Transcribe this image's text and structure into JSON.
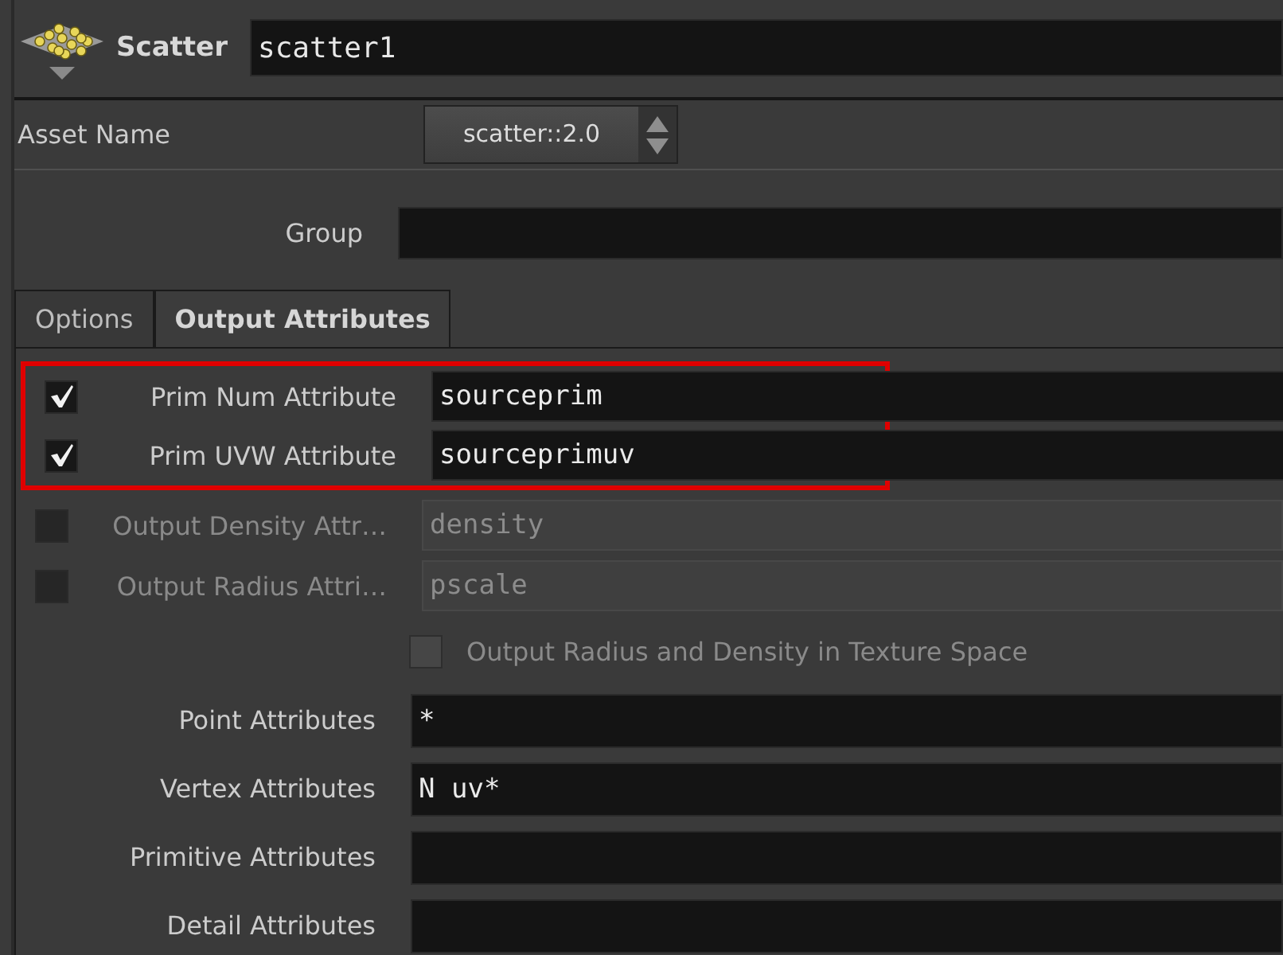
{
  "node": {
    "type_label": "Scatter",
    "name": "scatter1"
  },
  "asset": {
    "label": "Asset Name",
    "value": "scatter::2.0"
  },
  "group": {
    "label": "Group"
  },
  "tabs": [
    {
      "label": "Options",
      "selected": false
    },
    {
      "label": "Output Attributes",
      "selected": true
    }
  ],
  "rows": [
    {
      "kind": "check_field",
      "label": "Prim Num Attribute",
      "checked": true,
      "disabled": false,
      "value": "sourceprim",
      "highlighted": true
    },
    {
      "kind": "check_field",
      "label": "Prim UVW Attribute",
      "checked": true,
      "disabled": false,
      "value": "sourceprimuv",
      "highlighted": true
    },
    {
      "kind": "check_field",
      "label": "Output Density Attr…",
      "checked": false,
      "disabled": true,
      "value": "density",
      "highlighted": false
    },
    {
      "kind": "check_field",
      "label": "Output Radius Attri…",
      "checked": false,
      "disabled": true,
      "value": "pscale",
      "highlighted": false
    },
    {
      "kind": "checkbox",
      "label": "Output Radius and Density in Texture Space",
      "checked": false,
      "disabled": true,
      "highlighted": false
    },
    {
      "kind": "field",
      "label": "Point Attributes",
      "value": "*",
      "disabled": false,
      "highlighted": false
    },
    {
      "kind": "field",
      "label": "Vertex Attributes",
      "value": "N uv*",
      "disabled": false,
      "highlighted": false
    },
    {
      "kind": "field",
      "label": "Primitive Attributes",
      "disabled": false,
      "highlighted": false
    },
    {
      "kind": "field",
      "label": "Detail Attributes",
      "disabled": false,
      "highlighted": false
    }
  ]
}
